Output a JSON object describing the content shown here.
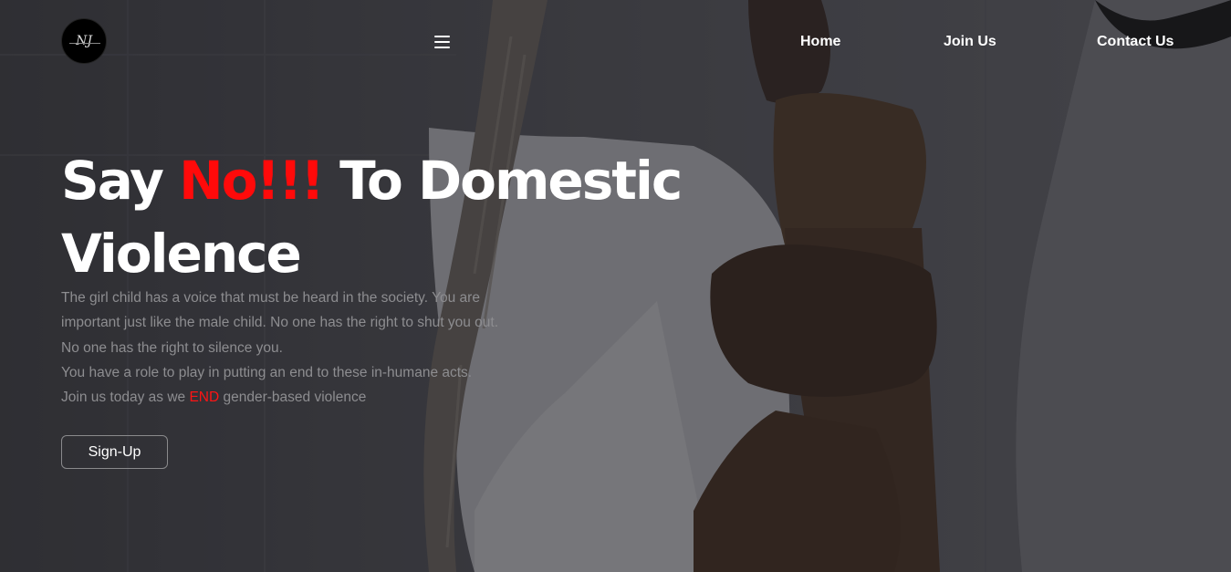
{
  "brand": {
    "logo_text": "NJ"
  },
  "nav": {
    "home": "Home",
    "join": "Join Us",
    "contact": "Contact Us"
  },
  "hero": {
    "headline_part1": "Say ",
    "headline_accent": "No!!!",
    "headline_part2": " To Domestic Violence",
    "lines": [
      "The girl child has a voice that must be heard in the society. You are",
      "important just like the male child. No one has the right to shut you out.",
      "No one has the right to silence you.",
      "You have a role to play in putting an end to these in-humane acts."
    ],
    "last_line_prefix": "Join us today as we ",
    "last_line_accent": "END",
    "last_line_suffix": " gender-based violence",
    "signup_label": "Sign-Up"
  },
  "colors": {
    "accent": "#ff0a0a",
    "text_muted": "#8d8d90",
    "nav_text": "#ffffff"
  },
  "icons": {
    "menu": "hamburger-menu-icon"
  }
}
